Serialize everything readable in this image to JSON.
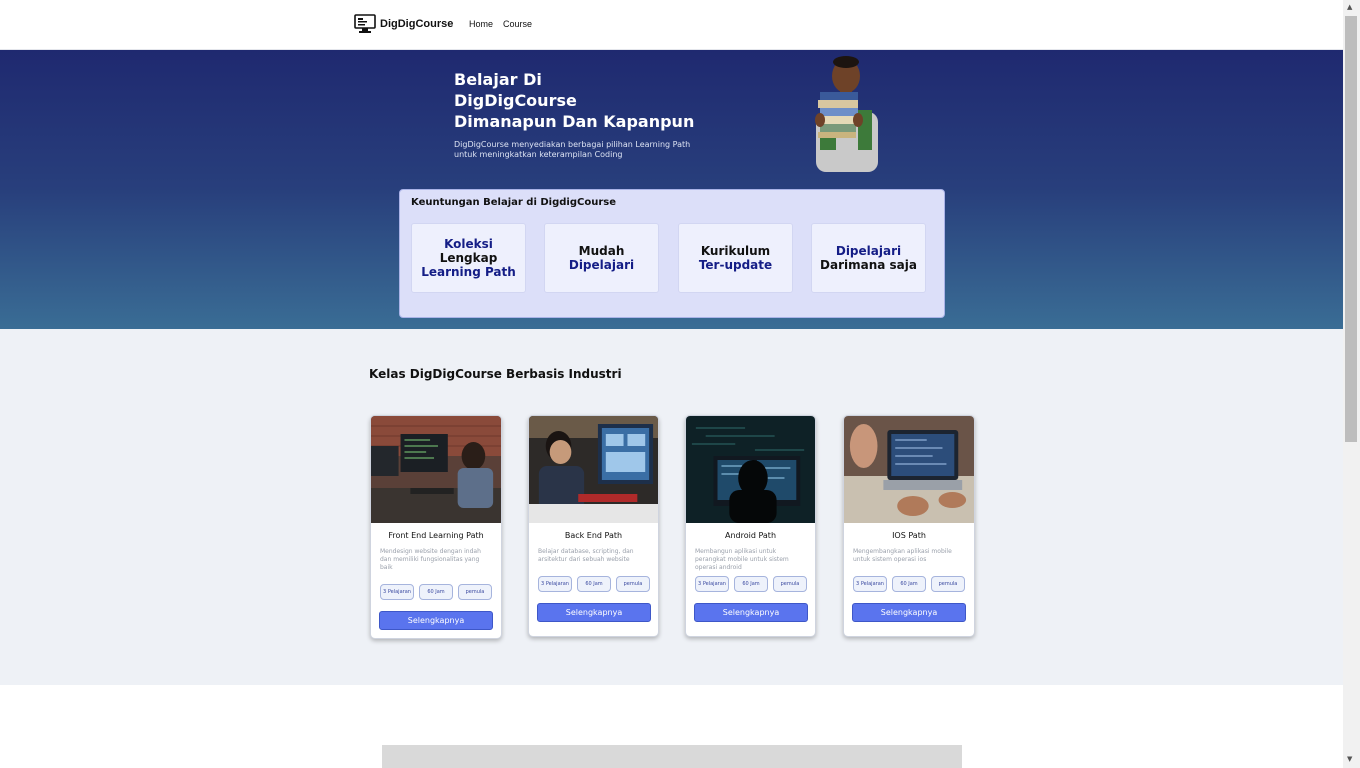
{
  "nav": {
    "brand": "DigDigCourse",
    "links": [
      "Home",
      "Course"
    ]
  },
  "hero": {
    "title_lines": [
      "Belajar Di",
      "DigDigCourse",
      "Dimanapun Dan Kapanpun"
    ],
    "subtitle": "DigDigCourse menyediakan berbagai pilihan Learning Path untuk meningkatkan keterampilan Coding"
  },
  "benefits": {
    "title": "Keuntungan Belajar di DigdigCourse",
    "cards": [
      {
        "lines": [
          {
            "text": "Koleksi",
            "tone": "navy"
          },
          {
            "text": "Lengkap",
            "tone": "dark"
          },
          {
            "text": "Learning Path",
            "tone": "navy"
          }
        ]
      },
      {
        "lines": [
          {
            "text": "Mudah",
            "tone": "dark"
          },
          {
            "text": "Dipelajari",
            "tone": "navy"
          }
        ]
      },
      {
        "lines": [
          {
            "text": "Kurikulum",
            "tone": "dark"
          },
          {
            "text": "Ter-update",
            "tone": "navy"
          }
        ]
      },
      {
        "lines": [
          {
            "text": "Dipelajari",
            "tone": "navy"
          },
          {
            "text": "Darimana saja",
            "tone": "dark"
          }
        ]
      }
    ]
  },
  "classes": {
    "title": "Kelas DigDigCourse Berbasis Industri",
    "courses": [
      {
        "name": "Front End Learning Path",
        "desc": "Mendesign website dengan indah dan memiliki fungsionalitas yang baik",
        "tags": [
          "3 Pelajaran",
          "60 Jam",
          "pemula"
        ],
        "button": "Selengkapnya"
      },
      {
        "name": "Back End Path",
        "desc": "Belajar database, scripting, dan arsitektur dari sebuah website",
        "tags": [
          "3 Pelajaran",
          "60 Jam",
          "pemula"
        ],
        "button": "Selengkapnya"
      },
      {
        "name": "Android Path",
        "desc": "Membangun aplikasi untuk perangkat mobile untuk sistem operasi android",
        "tags": [
          "3 Pelajaran",
          "60 Jam",
          "pemula"
        ],
        "button": "Selengkapnya"
      },
      {
        "name": "IOS Path",
        "desc": "Mengembangkan aplikasi mobile untuk sistem operasi ios",
        "tags": [
          "3 Pelajaran",
          "60 Jam",
          "pemula"
        ],
        "button": "Selengkapnya"
      }
    ]
  },
  "colors": {
    "hero_top": "#1f2970",
    "hero_bottom": "#3a6d95",
    "accent_navy": "#141d86",
    "button": "#5a74ee"
  }
}
